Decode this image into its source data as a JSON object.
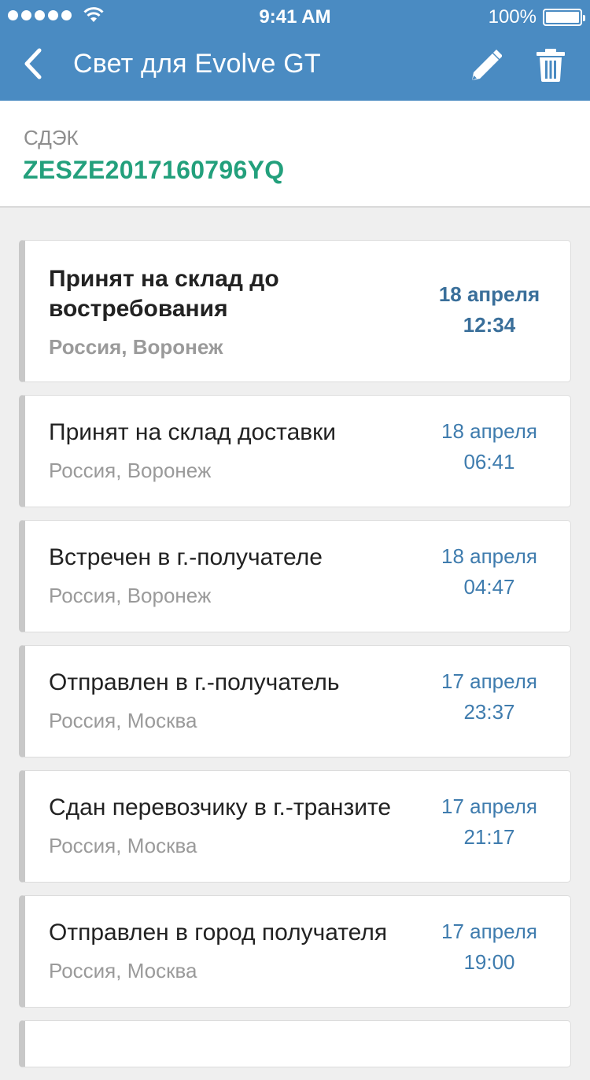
{
  "status_bar": {
    "time": "9:41 AM",
    "battery": "100%"
  },
  "nav": {
    "title": "Свет для Evolve GT",
    "back_icon": "chevron-left-icon",
    "edit_icon": "pencil-icon",
    "delete_icon": "trash-icon"
  },
  "shipment": {
    "carrier": "СДЭК",
    "tracking_number": "ZESZE2017160796YQ"
  },
  "events": [
    {
      "title": "Принят на склад до востребования",
      "location": "Россия, Воронеж",
      "date": "18 апреля",
      "time": "12:34",
      "highlighted": true
    },
    {
      "title": "Принят на склад доставки",
      "location": "Россия, Воронеж",
      "date": "18 апреля",
      "time": "06:41",
      "highlighted": false
    },
    {
      "title": "Встречен в г.-получателе",
      "location": "Россия, Воронеж",
      "date": "18 апреля",
      "time": "04:47",
      "highlighted": false
    },
    {
      "title": "Отправлен в г.-получатель",
      "location": "Россия, Москва",
      "date": "17 апреля",
      "time": "23:37",
      "highlighted": false
    },
    {
      "title": "Сдан перевозчику в г.-транзите",
      "location": "Россия, Москва",
      "date": "17 апреля",
      "time": "21:17",
      "highlighted": false
    },
    {
      "title": "Отправлен в город получателя",
      "location": "Россия, Москва",
      "date": "17 апреля",
      "time": "19:00",
      "highlighted": false
    }
  ],
  "colors": {
    "header": "#4a8bc2",
    "tracking": "#23a07c",
    "date": "#3f7cae"
  }
}
